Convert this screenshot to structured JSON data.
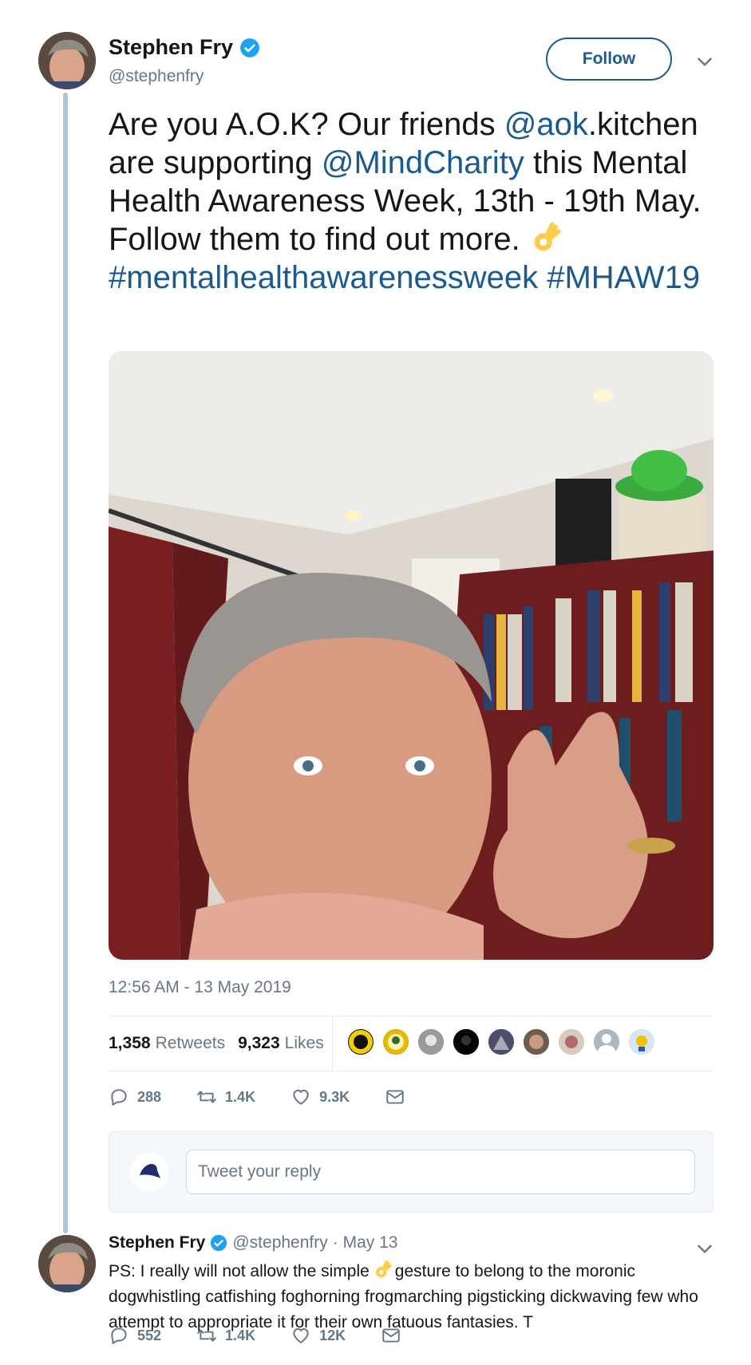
{
  "tweet": {
    "author_name": "Stephen Fry",
    "handle": "@stephenfry",
    "follow_label": "Follow",
    "text_1": "Are you A.O.K? Our friends ",
    "mention_1": "@aok",
    "text_2": ".kitchen are supporting ",
    "mention_2": "@MindCharity",
    "text_3": " this Mental Health Awareness Week, 13th - 19th May. Follow them to find out more. ",
    "hashtag_1": "#mentalhealthawarenessweek",
    "hashtag_2": "#MHAW19",
    "timestamp": "12:56 AM - 13 May 2019",
    "retweets_count": "1,358",
    "retweets_label": "Retweets",
    "likes_count": "9,323",
    "likes_label": "Likes",
    "actions": {
      "replies": "288",
      "retweets": "1.4K",
      "likes": "9.3K"
    }
  },
  "reply_box": {
    "placeholder": "Tweet your reply"
  },
  "reply_tweet": {
    "author_name": "Stephen Fry",
    "handle": "@stephenfry",
    "date": "· May 13",
    "text_1": "PS: I really will not allow the simple",
    "text_2": "gesture to belong to the moronic dogwhistling catfishing foghorning frogmarching pigsticking dickwaving few who attempt to appropriate it for their own fatuous fantasies. T",
    "actions": {
      "replies": "552",
      "retweets": "1.4K",
      "likes": "12K"
    }
  },
  "colors": {
    "link": "#1b5a8e",
    "verified": "#1da1f2",
    "muted": "#657786",
    "thread_line": "#b0c6d8"
  },
  "icons": [
    "verified-icon",
    "chevron-down-icon",
    "reply-icon",
    "retweet-icon",
    "like-icon",
    "message-icon",
    "ok-hand-emoji"
  ]
}
